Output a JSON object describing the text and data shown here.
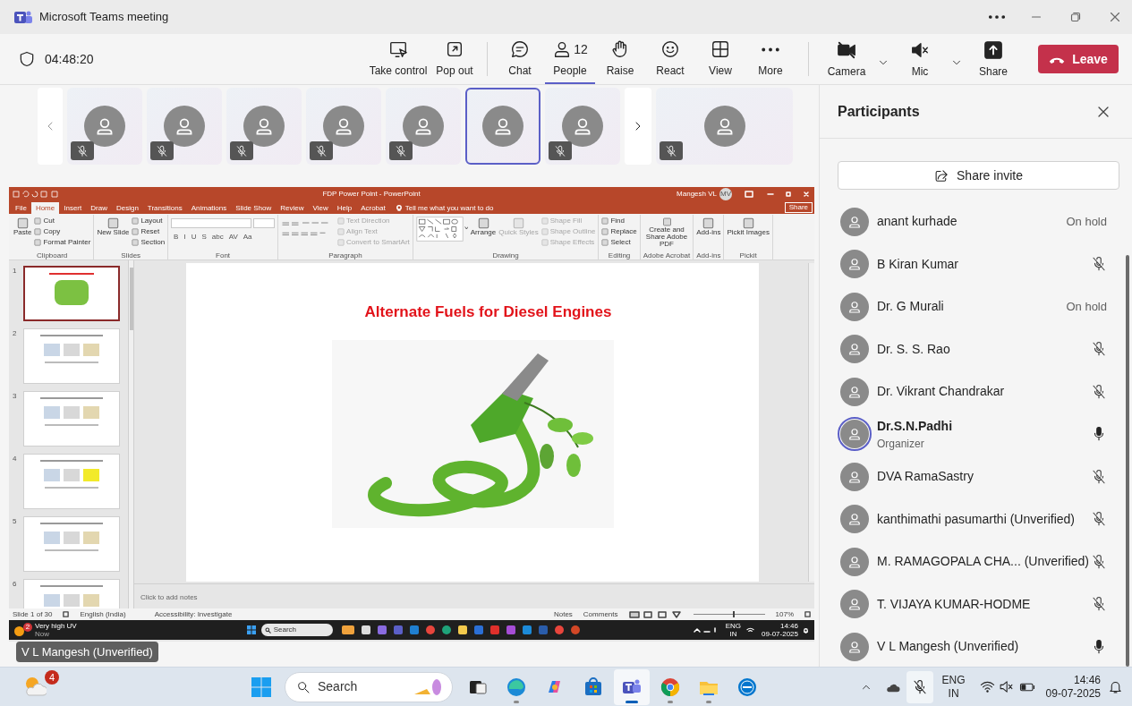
{
  "window": {
    "title": "Microsoft Teams meeting"
  },
  "meeting_bar": {
    "timer": "04:48:20",
    "buttons": [
      {
        "label": "Take control",
        "kind": "take_control",
        "selected": false
      },
      {
        "label": "Pop out",
        "kind": "pop_out",
        "selected": false
      },
      {
        "label": "Chat",
        "kind": "chat",
        "selected": false
      },
      {
        "label": "People",
        "kind": "people",
        "badge": "12",
        "selected": true
      },
      {
        "label": "Raise",
        "kind": "raise",
        "selected": false
      },
      {
        "label": "React",
        "kind": "react",
        "selected": false
      },
      {
        "label": "View",
        "kind": "view",
        "selected": false
      },
      {
        "label": "More",
        "kind": "more",
        "selected": false
      }
    ],
    "devices": [
      {
        "label": "Camera",
        "kind": "camera_off",
        "dropdown": true
      },
      {
        "label": "Mic",
        "kind": "speaker_off",
        "dropdown": true
      },
      {
        "label": "Share",
        "kind": "share",
        "dropdown": false
      }
    ],
    "leave": "Leave"
  },
  "video_strip": {
    "tiles": [
      {
        "muted": true,
        "active": false
      },
      {
        "muted": true,
        "active": false
      },
      {
        "muted": true,
        "active": false
      },
      {
        "muted": true,
        "active": false
      },
      {
        "muted": true,
        "active": false
      },
      {
        "muted": false,
        "active": true
      },
      {
        "muted": true,
        "active": false
      }
    ],
    "overflow_tile": {
      "muted": true
    }
  },
  "shared_screen": {
    "title": "FDP Power Point  -  PowerPoint",
    "user": "Mangesh VL",
    "user_initials": "MV",
    "tabs": [
      {
        "label": "File",
        "selected": false
      },
      {
        "label": "Home",
        "selected": true
      },
      {
        "label": "Insert",
        "selected": false
      },
      {
        "label": "Draw",
        "selected": false
      },
      {
        "label": "Design",
        "selected": false
      },
      {
        "label": "Transitions",
        "selected": false
      },
      {
        "label": "Animations",
        "selected": false
      },
      {
        "label": "Slide Show",
        "selected": false
      },
      {
        "label": "Review",
        "selected": false
      },
      {
        "label": "View",
        "selected": false
      },
      {
        "label": "Help",
        "selected": false
      },
      {
        "label": "Acrobat",
        "selected": false
      }
    ],
    "tell_me": "Tell me what you want to do",
    "share": "Share",
    "ribbon_groups": [
      {
        "label": "Clipboard",
        "kind": "tools",
        "items": [
          {
            "label": "Paste",
            "kind": "large",
            "disabled": false
          },
          {
            "label": "Cut",
            "kind": "small",
            "disabled": false
          },
          {
            "label": "Copy",
            "kind": "small",
            "disabled": false
          },
          {
            "label": "Format Painter",
            "kind": "small",
            "disabled": false
          }
        ]
      },
      {
        "label": "Slides",
        "kind": "tools",
        "items": [
          {
            "label": "New Slide",
            "kind": "large",
            "disabled": false
          },
          {
            "label": "Layout",
            "kind": "small",
            "disabled": false
          },
          {
            "label": "Reset",
            "kind": "small",
            "disabled": false
          },
          {
            "label": "Section",
            "kind": "small",
            "disabled": false
          }
        ]
      },
      {
        "label": "Font",
        "kind": "font",
        "buttons": [
          "B",
          "I",
          "U",
          "S",
          "abc",
          "AV",
          "Aa"
        ]
      },
      {
        "label": "Paragraph",
        "kind": "tools",
        "items": [
          {
            "kind": "icon_grid",
            "disabled": false
          },
          {
            "label": "Text Direction",
            "kind": "small",
            "disabled": true
          },
          {
            "label": "Align Text",
            "kind": "small",
            "disabled": true
          },
          {
            "label": "Convert to SmartArt",
            "kind": "small",
            "disabled": true
          }
        ]
      },
      {
        "label": "Drawing",
        "kind": "tools",
        "items": [
          {
            "kind": "gallery",
            "disabled": false
          },
          {
            "label": "Arrange",
            "kind": "large",
            "disabled": false
          },
          {
            "label": "Quick Styles",
            "kind": "large",
            "disabled": true
          },
          {
            "label": "Shape Fill",
            "kind": "small",
            "disabled": true
          },
          {
            "label": "Shape Outline",
            "kind": "small",
            "disabled": true
          },
          {
            "label": "Shape Effects",
            "kind": "small",
            "disabled": true
          }
        ]
      },
      {
        "label": "Editing",
        "kind": "tools",
        "items": [
          {
            "label": "Find",
            "kind": "small",
            "disabled": false
          },
          {
            "label": "Replace",
            "kind": "small",
            "disabled": false
          },
          {
            "label": "Select",
            "kind": "small",
            "disabled": false
          }
        ]
      },
      {
        "label": "Adobe Acrobat",
        "kind": "tools",
        "items": [
          {
            "label": "Create and Share Adobe PDF",
            "kind": "large",
            "disabled": false
          }
        ]
      },
      {
        "label": "Add-ins",
        "kind": "tools",
        "items": [
          {
            "label": "Add-ins",
            "kind": "large",
            "disabled": false
          }
        ]
      },
      {
        "label": "Pickit",
        "kind": "tools",
        "items": [
          {
            "label": "Pickit Images",
            "kind": "large",
            "disabled": false
          }
        ]
      }
    ],
    "slides": [
      {
        "number": "1",
        "selected": true
      },
      {
        "number": "2",
        "selected": false
      },
      {
        "number": "3",
        "selected": false
      },
      {
        "number": "4",
        "selected": false
      },
      {
        "number": "5",
        "selected": false
      },
      {
        "number": "6",
        "selected": false
      }
    ],
    "slide_title": "Alternate Fuels for Diesel Engines",
    "notes_placeholder": "Click to add notes",
    "status": {
      "slide": "Slide 1 of 30",
      "language": "English (India)",
      "accessibility": "Accessibility: Investigate",
      "notes": "Notes",
      "comments": "Comments",
      "zoom": "107%",
      "level": 0.55
    },
    "inner_taskbar": {
      "notification": {
        "title": "Very high UV",
        "time": "Now",
        "badge": "2"
      },
      "search": "Search",
      "lang": [
        "ENG",
        "IN"
      ],
      "time": "14:46",
      "date": "09-07-2025"
    },
    "presenter_label": "V L Mangesh (Unverified)"
  },
  "participants": {
    "title": "Participants",
    "share_invite": "Share invite",
    "people": [
      {
        "name": "anant kurhade",
        "status": "On hold",
        "highlighted": false
      },
      {
        "name": "B Kiran Kumar",
        "muted": true,
        "highlighted": false
      },
      {
        "name": "Dr. G Murali",
        "status": "On hold",
        "highlighted": false
      },
      {
        "name": "Dr. S. S. Rao",
        "muted": true,
        "highlighted": false
      },
      {
        "name": "Dr. Vikrant Chandrakar",
        "muted": true,
        "highlighted": false
      },
      {
        "name": "Dr.S.N.Padhi",
        "role": "Organizer",
        "muted": false,
        "highlighted": true
      },
      {
        "name": "DVA RamaSastry",
        "muted": true,
        "highlighted": false
      },
      {
        "name": "kanthimathi pasumarthi (Unverified)",
        "muted": true,
        "highlighted": false
      },
      {
        "name": "M. RAMAGOPALA CHA...  (Unverified)",
        "muted": true,
        "highlighted": false
      },
      {
        "name": "T. VIJAYA KUMAR-HODME",
        "muted": true,
        "highlighted": false
      },
      {
        "name": "V L Mangesh (Unverified)",
        "muted": false,
        "highlighted": false
      }
    ]
  },
  "taskbar": {
    "weather_badge": "4",
    "search": "Search",
    "apps": [
      {
        "kind": "task_view",
        "active": false,
        "running": false
      },
      {
        "kind": "edge",
        "active": false,
        "running": true
      },
      {
        "kind": "copilot",
        "active": false,
        "running": false
      },
      {
        "kind": "store",
        "active": false,
        "running": false
      },
      {
        "kind": "teams",
        "active": true,
        "running": true
      },
      {
        "kind": "chrome",
        "active": false,
        "running": true
      },
      {
        "kind": "explorer",
        "active": false,
        "running": true
      },
      {
        "kind": "dell",
        "active": false,
        "running": false
      }
    ],
    "lang": [
      "ENG",
      "IN"
    ],
    "time": "14:46",
    "date": "09-07-2025"
  }
}
